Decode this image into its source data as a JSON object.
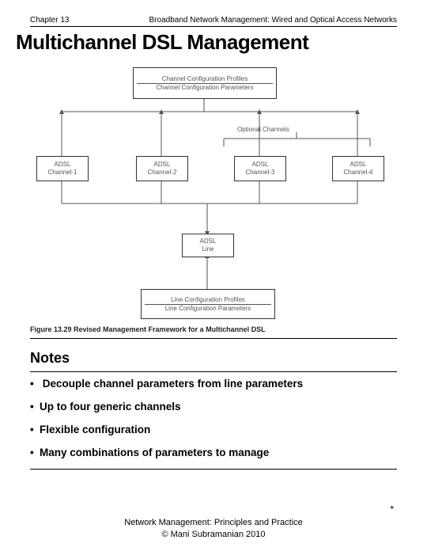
{
  "header": {
    "chapter": "Chapter 13",
    "topic": "Broadband Network Management: Wired and Optical Access Networks"
  },
  "title": "Multichannel DSL Management",
  "diagram": {
    "top_box": {
      "line1": "Channel Configuration Profiles",
      "line2": "Channel Configuration Parameters"
    },
    "optional_label": "Optional Channels",
    "channels": [
      {
        "line1": "ADSL",
        "line2": "Channel-1"
      },
      {
        "line1": "ADSL",
        "line2": "Channel-2"
      },
      {
        "line1": "ADSL",
        "line2": "Channel-3"
      },
      {
        "line1": "ADSL",
        "line2": "Channel-4"
      }
    ],
    "line_box": {
      "line1": "ADSL",
      "line2": "Line"
    },
    "bottom_box": {
      "line1": "Line Configuration Profiles",
      "line2": "Line Configuration Parameters"
    },
    "caption": "Figure 13.29  Revised Management Framework for a Multichannel DSL"
  },
  "notes": {
    "heading": "Notes",
    "items": [
      "Decouple channel parameters from line parameters",
      "Up to four generic channels",
      "Flexible configuration",
      "Many combinations of parameters to manage"
    ]
  },
  "footer": {
    "line1": "Network Management: Principles and Practice",
    "line2": "©  Mani Subramanian 2010",
    "asterisk": "*"
  }
}
